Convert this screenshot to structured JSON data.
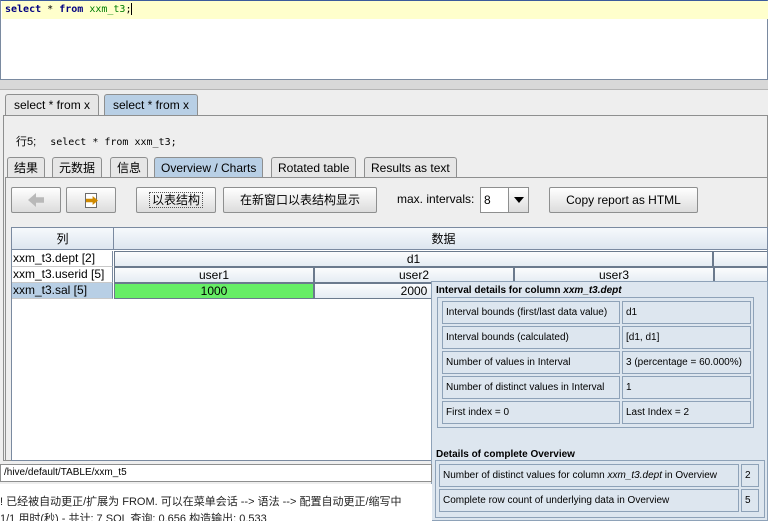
{
  "editor": {
    "sql_keyword1": "select",
    "sql_star": " * ",
    "sql_keyword2": "from",
    "sql_table": "xxm_t3",
    "sql_end": ";"
  },
  "query_tabs": [
    {
      "label": "select * from x",
      "active": false
    },
    {
      "label": "select * from x",
      "active": true
    }
  ],
  "row_info": {
    "label": "行5;",
    "sql": "select * from xxm_t3;"
  },
  "result_tabs": [
    {
      "label": "结果"
    },
    {
      "label": "元数据"
    },
    {
      "label": "信息"
    },
    {
      "label": "Overview / Charts",
      "active": true
    },
    {
      "label": "Rotated table"
    },
    {
      "label": "Results as text"
    }
  ],
  "toolbar": {
    "back_icon": "arrow-left-icon",
    "forward_icon": "page-arrow-right-icon",
    "show_table_label": "以表结构",
    "show_new_window_label": "在新窗口以表结构显示",
    "max_intervals_label": "max. intervals:",
    "max_intervals_value": "8",
    "copy_html_label": "Copy report as HTML"
  },
  "grid": {
    "col_header": "列",
    "data_header": "数据",
    "rows": [
      {
        "label": "xxm_t3.dept [2]",
        "cells": [
          "d1"
        ]
      },
      {
        "label": "xxm_t3.userid [5]",
        "cells": [
          "user1",
          "user2",
          "user3"
        ]
      },
      {
        "label": "xxm_t3.sal [5]",
        "cells": [
          "1000",
          "2000"
        ]
      }
    ],
    "highlight_color": "#66ee66"
  },
  "popup": {
    "title_prefix": "Interval details for column ",
    "title_column": "xxm_t3.dept",
    "details": {
      "bounds_first_last_label": "Interval bounds (first/last data value)",
      "bounds_first_last_value": "d1",
      "bounds_calc_label": "Interval bounds (calculated)",
      "bounds_calc_value": "[d1, d1]",
      "num_values_label": "Number of values in Interval",
      "num_values_value": "3 (percentage = 60.000%)",
      "num_distinct_label": "Number of distinct values in Interval",
      "num_distinct_value": "1",
      "first_index": "First index = 0",
      "last_index": "Last Index = 2"
    },
    "overview_title": "Details of complete Overview",
    "overview": {
      "distinct_prefix": "Number of distinct values for column ",
      "distinct_column": "xxm_t3.dept",
      "distinct_suffix": " in Overview",
      "distinct_value": "2",
      "rowcount_label": "Complete row count of underlying data in Overview",
      "rowcount_value": "5"
    }
  },
  "status": {
    "path": "/hive/default/TABLE/xxm_t5",
    "log1": "! 已经被自动更正/扩展为 FROM. 可以在菜单会话 --> 语法 --> 配置自动更正/缩写中",
    "log2": "1/1 用时(秒) - 共计: 7  SQL 查询: 0.656  构造输出: 0.533"
  }
}
